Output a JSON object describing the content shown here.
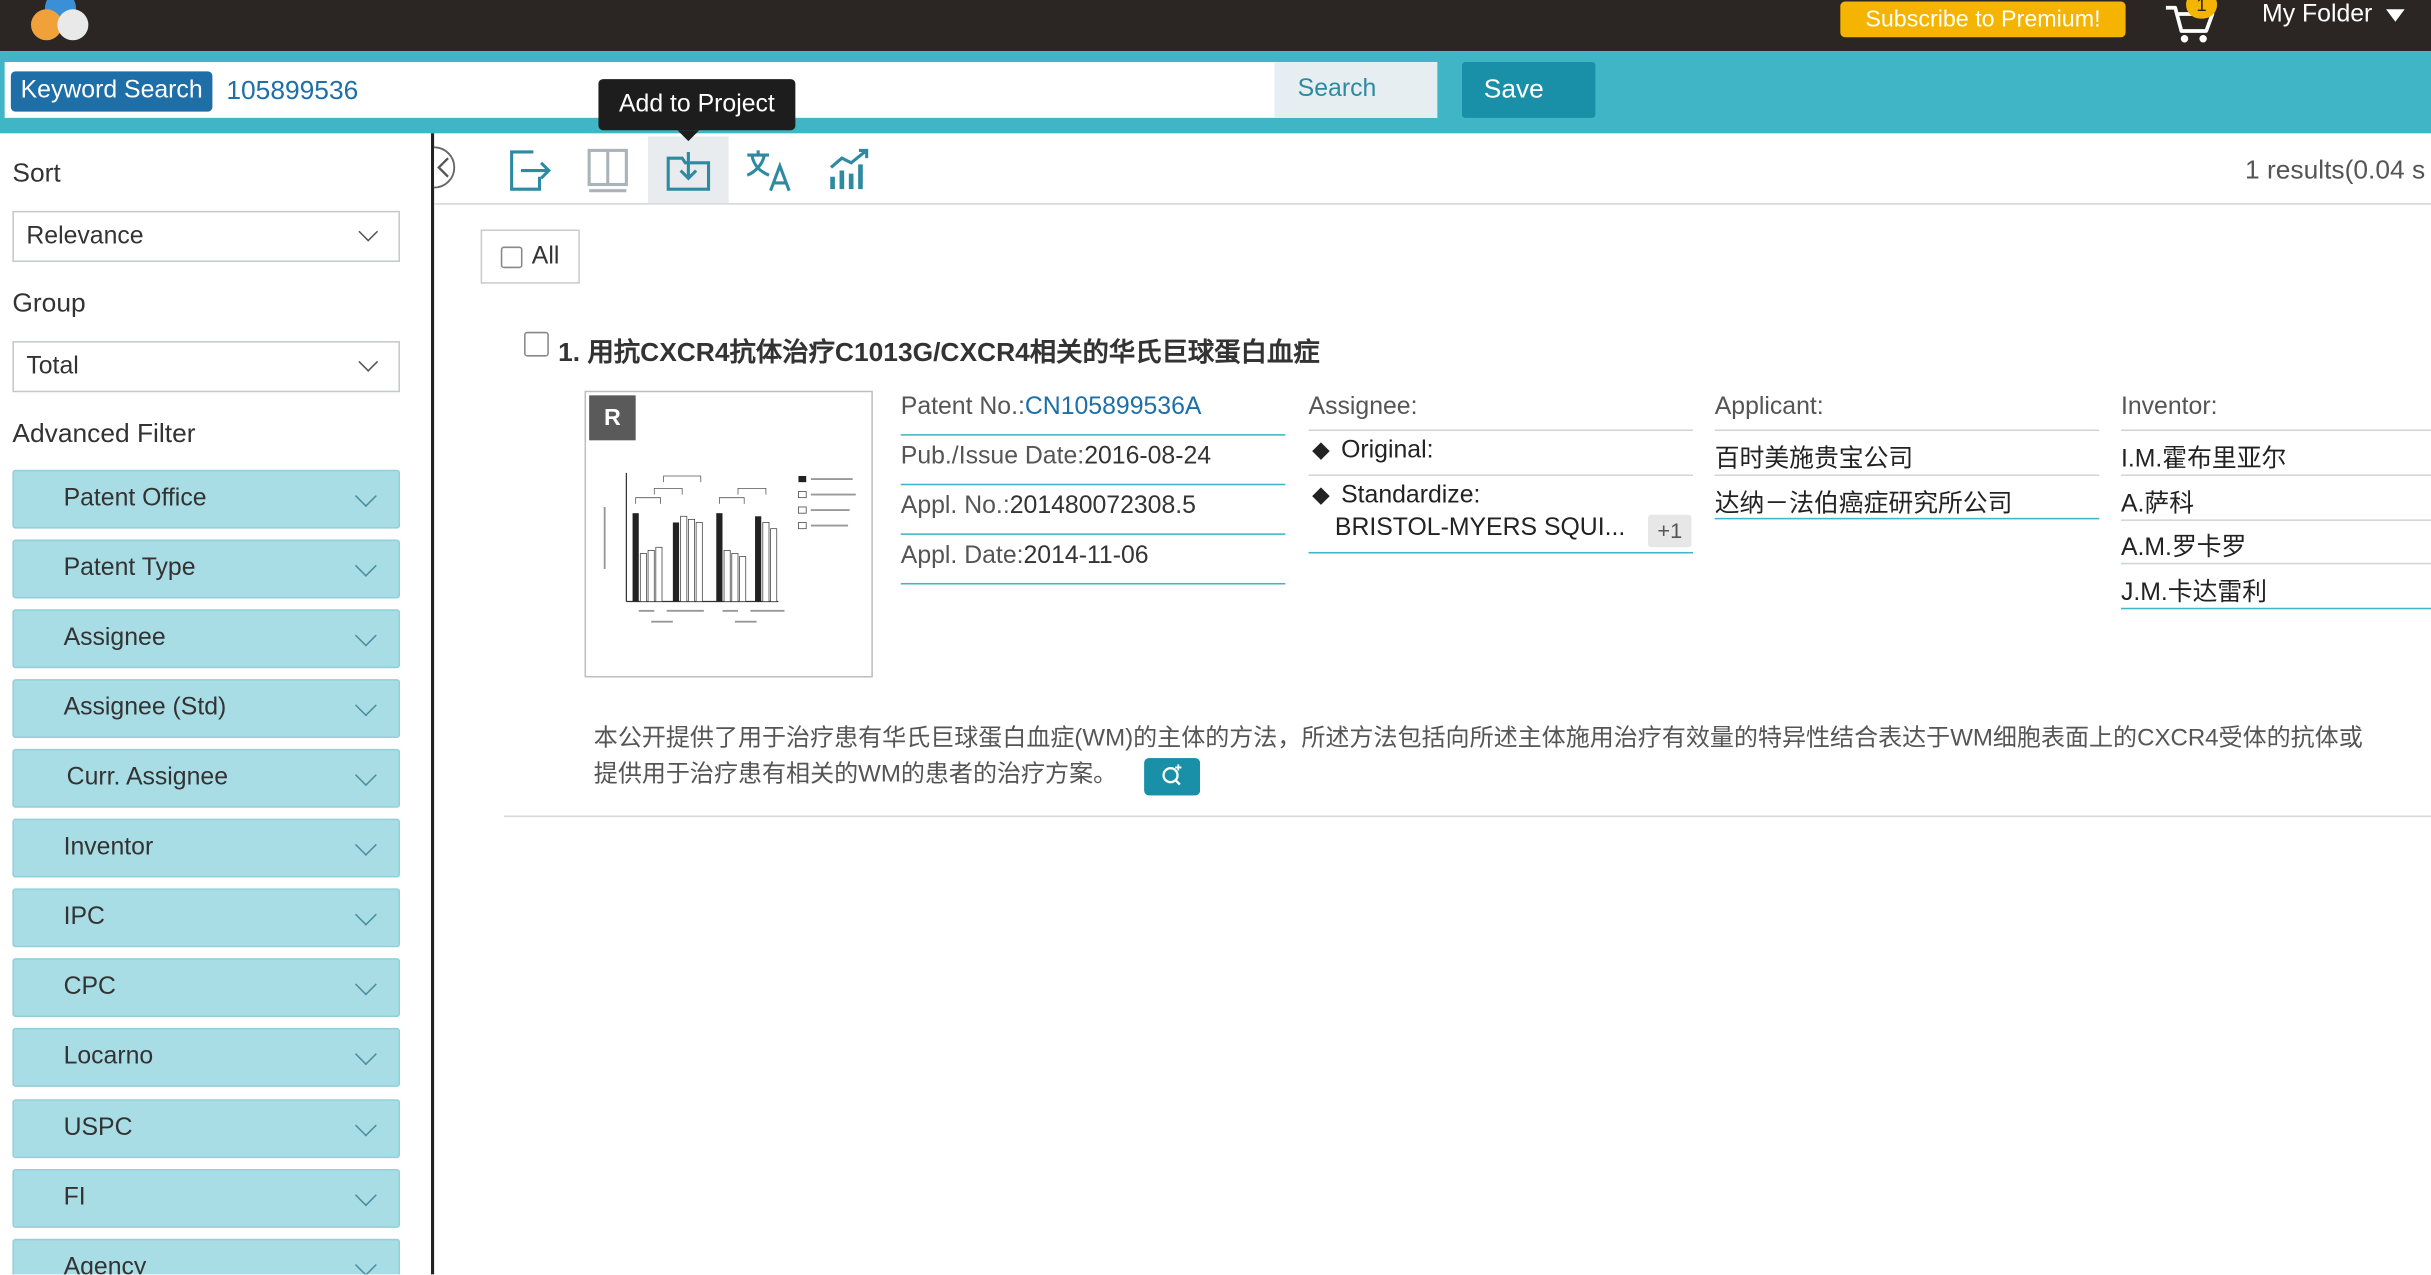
{
  "header": {
    "subscribe_label": "Subscribe to Premium!",
    "cart_count": "1",
    "my_folder_label": "My Folder"
  },
  "search": {
    "mode_label": "Keyword Search",
    "query": "105899536",
    "search_button": "Search",
    "save_button": "Save"
  },
  "tooltip": "Add to Project",
  "sidebar": {
    "sort_label": "Sort",
    "sort_value": "Relevance",
    "group_label": "Group",
    "group_value": "Total",
    "advanced_label": "Advanced Filter",
    "filters": [
      "Patent Office",
      "Patent Type",
      "Assignee",
      "Assignee (Std)",
      "Curr. Assignee",
      "Inventor",
      "IPC",
      "CPC",
      "Locarno",
      "USPC",
      "FI",
      "Agency"
    ]
  },
  "toolbar": {
    "results_text": "1 results(0.04 s"
  },
  "results": {
    "all_label": "All",
    "item": {
      "title": "1. 用抗CXCR4抗体治疗C1013G/CXCR4相关的华氏巨球蛋白血症",
      "thumb_badge": "R",
      "patent_no_label": "Patent No.:",
      "patent_no": "CN105899536A",
      "pub_date_label": "Pub./Issue Date:",
      "pub_date": "2016-08-24",
      "appl_no_label": "Appl. No.:",
      "appl_no": "201480072308.5",
      "appl_date_label": "Appl. Date:",
      "appl_date": "2014-11-06",
      "assignee_label": "Assignee:",
      "original_label": "Original:",
      "standardize_label": "Standardize:",
      "standardize_value": "BRISTOL-MYERS SQUI...",
      "plus_more": "+1",
      "applicant_label": "Applicant:",
      "applicants": [
        "百时美施贵宝公司",
        "达纳－法伯癌症研究所公司"
      ],
      "inventor_label": "Inventor:",
      "inventors": [
        "I.M.霍布里亚尔",
        "A.萨科",
        "A.M.罗卡罗",
        "J.M.卡达雷利"
      ],
      "abstract_line1": "本公开提供了用于治疗患有华氏巨球蛋白血症(WM)的主体的方法，所述方法包括向所述主体施用治疗有效量的特异性结合表达于WM细胞表面上的CXCR4受体的抗体或",
      "abstract_line2": "提供用于治疗患有相关的WM的患者的治疗方案。"
    }
  },
  "colors": {
    "topbar": "#2b2623",
    "accent": "#3fb5c6",
    "subscribe": "#f5b400",
    "link": "#1e6ea8",
    "filter_bg": "#a9dde6"
  }
}
